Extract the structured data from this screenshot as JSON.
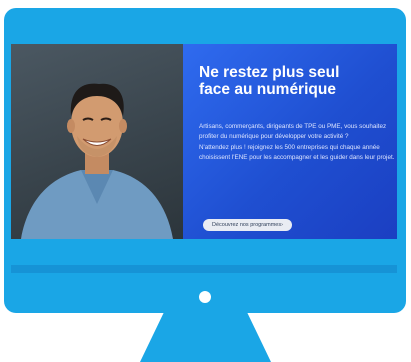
{
  "hero": {
    "title_line1": "Ne restez plus seul",
    "title_line2": "face au numérique",
    "paragraph1": "Artisans, commerçants, dirigeants de TPE ou PME, vous souhaitez profiter du numérique pour développer votre activité ?",
    "paragraph2": "N'attendez plus ! rejoignez les 500 entreprises qui chaque année choisissent l'ENE pour les accompagner et les guider dans leur projet.",
    "cta_label": "Découvrez nos programmes›"
  },
  "colors": {
    "monitor_frame": "#1aa6e6",
    "hero_background": "#1f4fd1",
    "cta_background": "#e9ecf3"
  }
}
